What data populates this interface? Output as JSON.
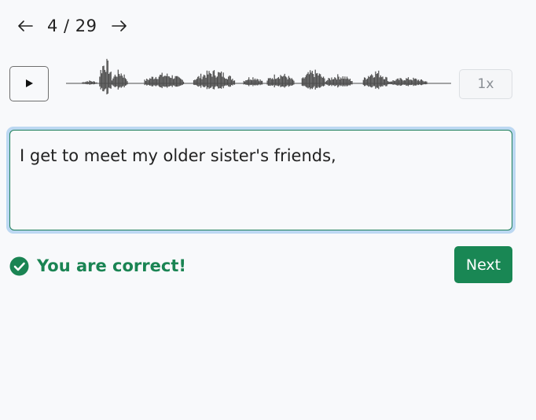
{
  "navigation": {
    "prev_icon": "arrow-left-icon",
    "counter": "4 / 29",
    "next_icon": "arrow-right-icon"
  },
  "player": {
    "play_icon": "play-icon",
    "speed_label": "1x",
    "waveform_color": "#4d4d4d"
  },
  "answer": {
    "value": "I get to meet my older sister's friends,",
    "focus_ring_color": "#bcd8f2",
    "border_color": "#1e7f5a"
  },
  "feedback": {
    "icon": "check-circle-icon",
    "message": "You are correct!",
    "color": "#1a8453"
  },
  "actions": {
    "next_label": "Next",
    "next_color": "#198754"
  }
}
